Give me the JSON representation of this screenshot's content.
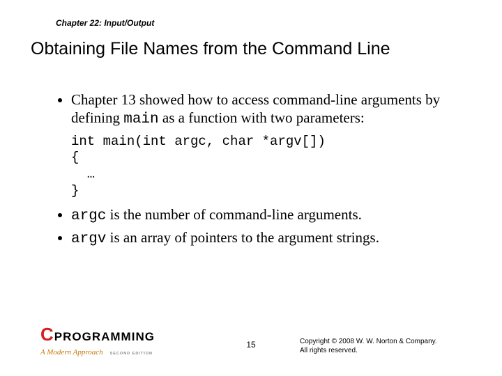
{
  "chapter_label": "Chapter 22: Input/Output",
  "title": "Obtaining File Names from the Command Line",
  "bullets": {
    "b1_pre": "Chapter 13 showed how to access command-line arguments by defining ",
    "b1_code": "main",
    "b1_post": " as a function with two parameters:",
    "code_line1": "int main(int argc, char *argv[])",
    "code_line2": "{",
    "code_line3": "  …",
    "code_line4": "}",
    "b2_code": "argc",
    "b2_post": " is the number of command-line arguments.",
    "b3_code": "argv",
    "b3_post": " is an array of pointers to the argument strings."
  },
  "footer": {
    "logo_c": "C",
    "logo_prog": "PROGRAMMING",
    "logo_sub": "A Modern Approach",
    "logo_ed": "SECOND EDITION",
    "page": "15",
    "copyright_l1": "Copyright © 2008 W. W. Norton & Company.",
    "copyright_l2": "All rights reserved."
  }
}
